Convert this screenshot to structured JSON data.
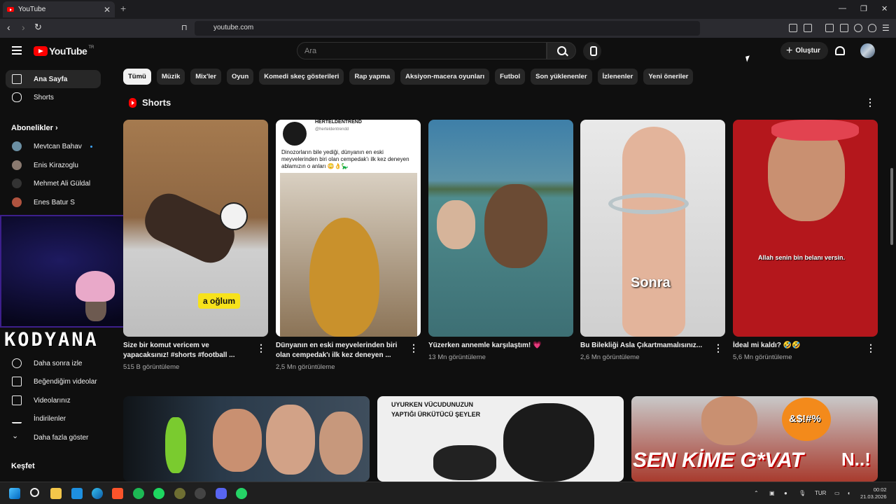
{
  "browser": {
    "tab_title": "YouTube",
    "url": "youtube.com"
  },
  "header": {
    "logo_text": "YouTube",
    "region": "TR",
    "search_placeholder": "Ara",
    "create_label": "Oluştur"
  },
  "sidebar": {
    "items": [
      {
        "label": "Ana Sayfa",
        "icon": "home-icon"
      },
      {
        "label": "Shorts",
        "icon": "shorts-icon"
      }
    ],
    "subscriptions_title": "Abonelikler",
    "subscriptions": [
      {
        "label": "Mevtcan Bahav"
      },
      {
        "label": "Enis Kirazoglu"
      },
      {
        "label": "Mehmet Ali Güldal"
      },
      {
        "label": "Enes Batur S"
      }
    ],
    "you_items": [
      {
        "label": "Daha sonra izle",
        "icon": "clock-icon"
      },
      {
        "label": "Beğendiğim videolar",
        "icon": "thumbs-up-icon"
      },
      {
        "label": "Videolarınız",
        "icon": "video-icon"
      },
      {
        "label": "İndirilenler",
        "icon": "download-icon"
      },
      {
        "label": "Daha fazla göster",
        "icon": "chevron-down-icon"
      }
    ],
    "explore_title": "Keşfet"
  },
  "stream_overlay": {
    "name": "KODYANA"
  },
  "chips": [
    "Tümü",
    "Müzik",
    "Mix'ler",
    "Oyun",
    "Komedi skeç gösterileri",
    "Rap yapma",
    "Aksiyon-macera oyunları",
    "Futbol",
    "Son yüklenenler",
    "İzlenenler",
    "Yeni öneriler"
  ],
  "shorts": {
    "title": "Shorts",
    "items": [
      {
        "title": "Size bir komut vericem ve yapacaksınız! #shorts #football ...",
        "views": "515 B görüntüleme",
        "overlay": "a oğlum"
      },
      {
        "title": "Dünyanın en eski meyvelerinden biri olan cempedak'ı ilk kez deneyen ...",
        "views": "2,5 Mn görüntüleme",
        "overlay": "Dinozorların bile yediği, dünyanın en eski meyvelerinden biri olan cempedak'ı ilk kez deneyen ablamızın o anları 😳👌🦕",
        "channel": "HERTELDENTREND",
        "handle": "@herteldentrendd"
      },
      {
        "title": "Yüzerken annemle karşılaştım! 💗",
        "views": "13 Mn görüntüleme",
        "overlay": ""
      },
      {
        "title": "Bu Bilekliği Asla Çıkartmamalısınız...",
        "views": "2,6 Mn görüntüleme",
        "overlay": "Sonra"
      },
      {
        "title": "İdeal mi kaldı? 🤣🤣",
        "views": "5,6 Mn görüntüleme",
        "overlay": "Allah senin bin belanı versin."
      }
    ]
  },
  "videos": [
    {
      "overlay": ""
    },
    {
      "overlay": "UYURKEN VÜCUDUNUZUN YAPTIĞI ÜRKÜTÜCÜ ŞEYLER"
    },
    {
      "overlay": "SEN KİME G*VAT",
      "overlay2": "&$!#%",
      "overlay3": "N..!"
    }
  ],
  "taskbar": {
    "language": "TUR",
    "time": "00:02",
    "date": "21.03.2026"
  }
}
